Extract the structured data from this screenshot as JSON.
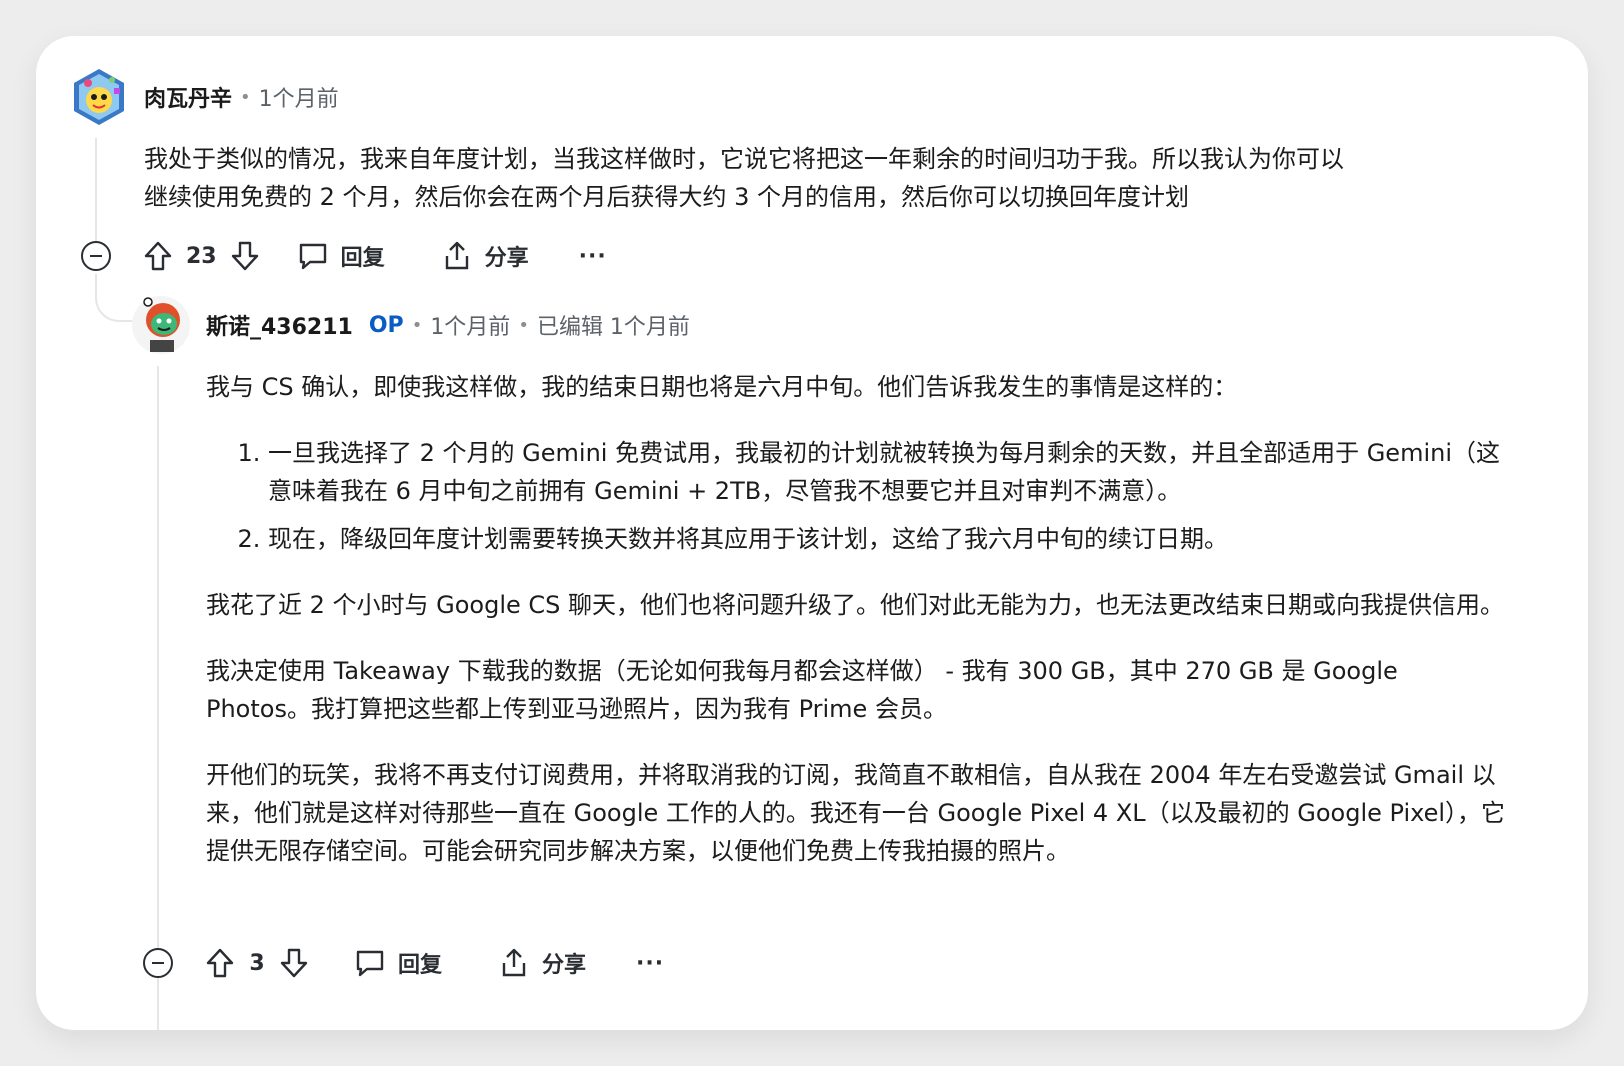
{
  "comment1": {
    "author": "肉瓦丹辛",
    "time": "1个月前",
    "body": [
      "我处于类似的情况，我来自年度计划，当我这样做时，它说它将把这一年剩余的时间归功于我。所以我认为你可以",
      "继续使用免费的 2 个月，然后你会在两个月后获得大约 3 个月的信用，然后你可以切换回年度计划"
    ],
    "votes": "23",
    "reply_label": "回复",
    "share_label": "分享",
    "more_label": "···"
  },
  "comment2": {
    "author": "斯诺_436211",
    "op_label": "OP",
    "time": "1个月前",
    "edited": "已编辑 1个月前",
    "intro": "我与 CS 确认，即使我这样做，我的结束日期也将是六月中旬。他们告诉我发生的事情是这样的：",
    "list": [
      "一旦我选择了 2 个月的 Gemini 免费试用，我最初的计划就被转换为每月剩余的天数，并且全部适用于 Gemini（这意味着我在 6 月中旬之前拥有 Gemini + 2TB，尽管我不想要它并且对审判不满意）。",
      "现在，降级回年度计划需要转换天数并将其应用于该计划，这给了我六月中旬的续订日期。"
    ],
    "para2": "我花了近 2 个小时与 Google CS 聊天，他们也将问题升级了。他们对此无能为力，也无法更改结束日期或向我提供信用。",
    "para3": "我决定使用 Takeaway 下载我的数据（无论如何我每月都会这样做） - 我有 300 GB，其中 270 GB 是 Google Photos。我打算把这些都上传到亚马逊照片，因为我有 Prime 会员。",
    "para4": "开他们的玩笑，我将不再支付订阅费用，并将取消我的订阅，我简直不敢相信，自从我在 2004 年左右受邀尝试 Gmail 以来，他们就是这样对待那些一直在 Google 工作的人的。我还有一台 Google Pixel 4 XL（以及最初的 Google Pixel），它提供无限存储空间。可能会研究同步解决方案，以便他们免费上传我拍摄的照片。",
    "votes": "3",
    "reply_label": "回复",
    "share_label": "分享",
    "more_label": "···"
  },
  "colors": {
    "op_blue": "#0a5cc4",
    "thread_line": "#e4e6e8",
    "muted_text": "#5c6268"
  },
  "icons": [
    "avatar-snoo-1",
    "avatar-snoo-2",
    "collapse-icon",
    "upvote-icon",
    "downvote-icon",
    "comment-icon",
    "share-icon",
    "more-icon"
  ]
}
